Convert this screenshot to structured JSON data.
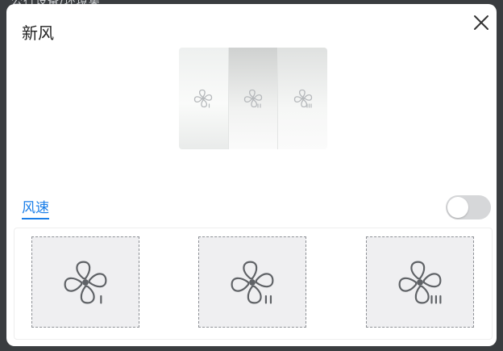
{
  "background": {
    "text": "公行设备/环境集"
  },
  "modal": {
    "title": "新风",
    "close_icon": "close-icon",
    "preview": {
      "panels": [
        {
          "icon": "fan-speed-1-icon",
          "level": "I"
        },
        {
          "icon": "fan-speed-2-icon",
          "level": "II"
        },
        {
          "icon": "fan-speed-3-icon",
          "level": "III"
        }
      ]
    },
    "fan_speed": {
      "label": "风速",
      "toggle_on": false,
      "accent_color": "#1a7ee8",
      "options": [
        {
          "icon": "fan-speed-1-icon",
          "level": "I"
        },
        {
          "icon": "fan-speed-2-icon",
          "level": "II"
        },
        {
          "icon": "fan-speed-3-icon",
          "level": "III"
        }
      ]
    }
  }
}
